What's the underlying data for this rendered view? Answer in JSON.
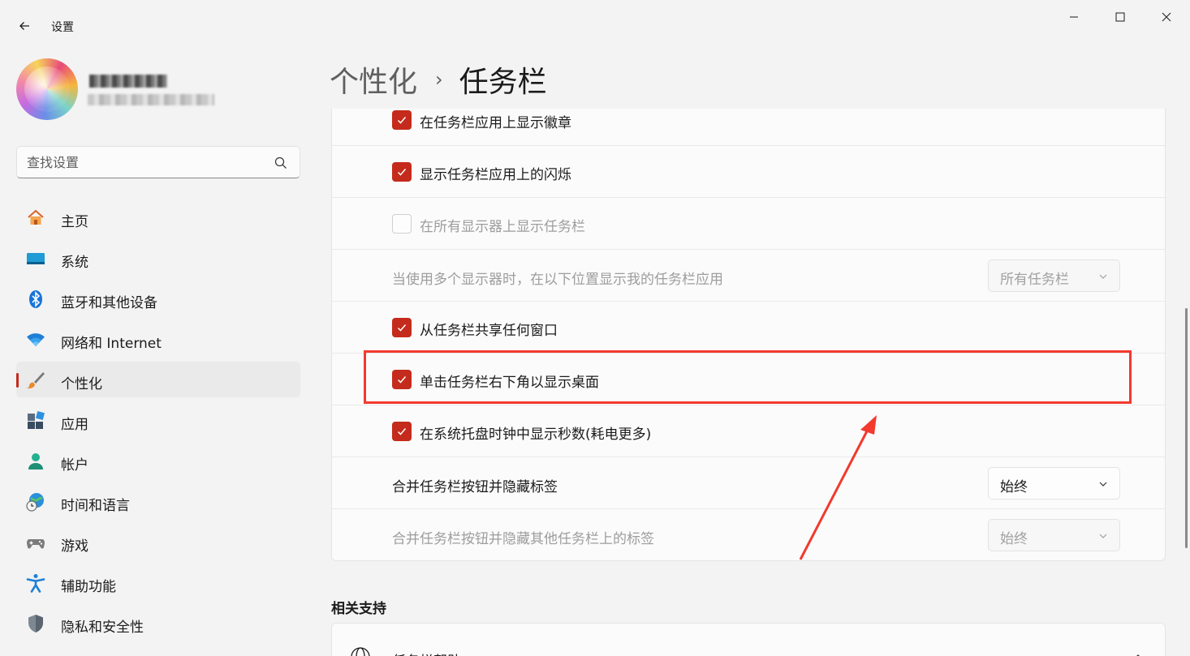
{
  "window": {
    "title": "设置"
  },
  "search": {
    "placeholder": "查找设置"
  },
  "nav": {
    "items": [
      {
        "label": "主页",
        "icon": "home-icon"
      },
      {
        "label": "系统",
        "icon": "system-icon"
      },
      {
        "label": "蓝牙和其他设备",
        "icon": "bluetooth-icon"
      },
      {
        "label": "网络和 Internet",
        "icon": "wifi-icon"
      },
      {
        "label": "个性化",
        "icon": "brush-icon",
        "active": true
      },
      {
        "label": "应用",
        "icon": "apps-icon"
      },
      {
        "label": "帐户",
        "icon": "account-icon"
      },
      {
        "label": "时间和语言",
        "icon": "globe-clock-icon"
      },
      {
        "label": "游戏",
        "icon": "gamepad-icon"
      },
      {
        "label": "辅助功能",
        "icon": "accessibility-icon"
      },
      {
        "label": "隐私和安全性",
        "icon": "shield-icon"
      }
    ]
  },
  "breadcrumb": {
    "parent": "个性化",
    "separator": "›",
    "current": "任务栏"
  },
  "settings": {
    "badges": {
      "label": "在任务栏应用上显示徽章",
      "checked": true
    },
    "flashing": {
      "label": "显示任务栏应用上的闪烁",
      "checked": true
    },
    "all_displays": {
      "label": "在所有显示器上显示任务栏",
      "checked": false
    },
    "multi_display_apps": {
      "label": "当使用多个显示器时，在以下位置显示我的任务栏应用",
      "value": "所有任务栏"
    },
    "share_window": {
      "label": "从任务栏共享任何窗口",
      "checked": true
    },
    "show_desktop": {
      "label": "单击任务栏右下角以显示桌面",
      "checked": true
    },
    "show_seconds": {
      "label": "在系统托盘时钟中显示秒数(耗电更多)",
      "checked": true
    },
    "combine_buttons": {
      "label": "合并任务栏按钮并隐藏标签",
      "value": "始终"
    },
    "combine_other": {
      "label": "合并任务栏按钮并隐藏其他任务栏上的标签",
      "value": "始终"
    }
  },
  "related": {
    "title": "相关支持",
    "item_label": "任务栏帮助"
  },
  "colors": {
    "accent": "#c42b1c",
    "highlight": "#f23a2e"
  }
}
